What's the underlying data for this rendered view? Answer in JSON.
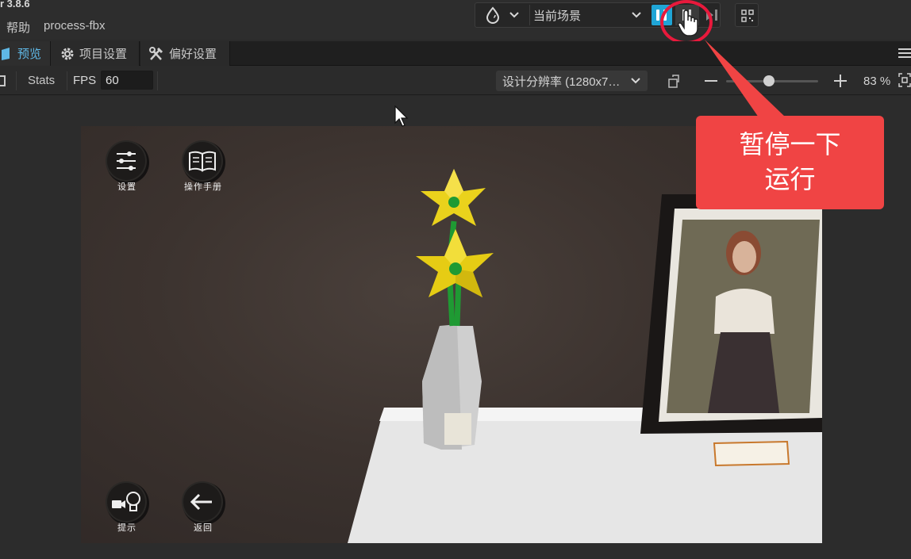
{
  "app": {
    "version": "r 3.8.6",
    "menu_help": "帮助",
    "project_name": "process-fbx"
  },
  "toolbar": {
    "scene_select": "当前场景"
  },
  "tabs": [
    {
      "label": "预览",
      "active": true
    },
    {
      "label": "项目设置",
      "active": false
    },
    {
      "label": "偏好设置",
      "active": false
    }
  ],
  "preview_toolbar": {
    "stats_label": "Stats",
    "fps_label": "FPS",
    "fps_value": "60",
    "resolution": "设计分辨率 (1280x7…",
    "zoom_percent": 83,
    "zoom_label": "83 %"
  },
  "game": {
    "buttons": {
      "settings": "设置",
      "manual": "操作手册",
      "hint": "提示",
      "back": "返回"
    }
  },
  "callout": {
    "line1": "暂停一下",
    "line2": "运行"
  },
  "colors": {
    "accent": "#1fa5d6",
    "highlight_ring": "#e8193c",
    "callout_bg": "#f04444"
  }
}
